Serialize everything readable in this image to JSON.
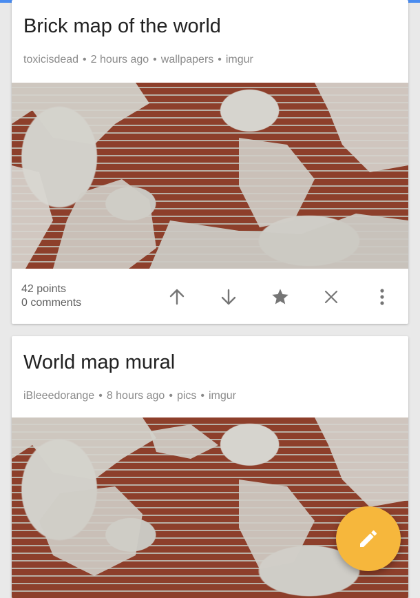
{
  "posts": [
    {
      "title": "Brick map of the world",
      "author": "toxicisdead",
      "time": "2 hours ago",
      "subreddit": "wallpapers",
      "domain": "imgur",
      "points": "42 points",
      "comments": "0 comments"
    },
    {
      "title": "World map mural",
      "author": "iBleeedorange",
      "time": "8 hours ago",
      "subreddit": "pics",
      "domain": "imgur"
    }
  ],
  "colors": {
    "accent_bar": "#4a8cf0",
    "fab": "#f6b73c",
    "brick": "#94432f",
    "plaster": "#d0cec8"
  },
  "icons": [
    "upvote-icon",
    "downvote-icon",
    "star-icon",
    "hide-icon",
    "more-vert-icon",
    "pencil-icon"
  ]
}
